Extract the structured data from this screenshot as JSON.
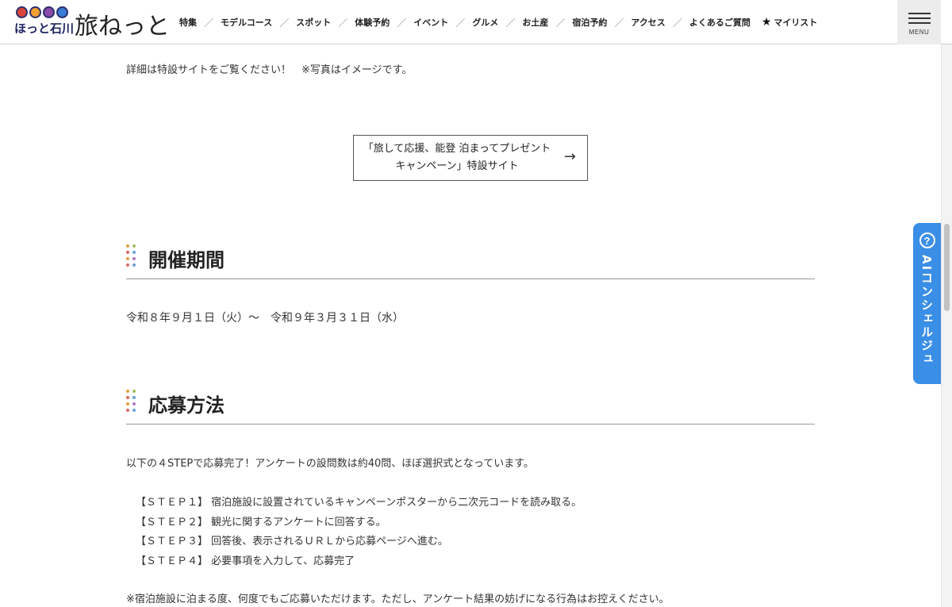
{
  "header": {
    "logo_small": "ほっと石川",
    "logo_big": "旅ねっと",
    "nav": [
      "特集",
      "モデルコース",
      "スポット",
      "体験予約",
      "イベント",
      "グルメ",
      "お土産",
      "宿泊予約",
      "アクセス",
      "よくあるご質問"
    ],
    "mylist_label": "マイリスト",
    "menu_label": "MENU",
    "logo_dot_colors": [
      "#d8443a",
      "#f0a030",
      "#8a4aa8",
      "#3a7bd5"
    ]
  },
  "content": {
    "intro": "詳細は特設サイトをご覧ください！　※写真はイメージです。",
    "link_label": "「旅して応援、能登 泊まってプレゼントキャンペーン」特設サイト",
    "period_heading": "開催期間",
    "period_text": "令和８年９月１日（火）～　令和９年３月３１日（水）",
    "method_heading": "応募方法",
    "method_intro": "以下の４STEPで応募完了！アンケートの設問数は約40問、ほぼ選択式となっています。",
    "steps": [
      "【ＳＴＥＰ１】 宿泊施設に設置されているキャンペーンポスターから二次元コードを読み取る。",
      "【ＳＴＥＰ２】 観光に関するアンケートに回答する。",
      "【ＳＴＥＰ３】 回答後、表示されるＵＲＬから応募ページへ進む。",
      "【ＳＴＥＰ４】 必要事項を入力して、応募完了"
    ],
    "note": "※宿泊施設に泊まる度、何度でもご応募いただけます。ただし、アンケート結果の妨げになる行為はお控えください。"
  },
  "concierge": {
    "label": "AIコンシェルジュ",
    "color": "#3a8ee6"
  },
  "heading_dot_colors": [
    "#e0a040",
    "#9fbf5a",
    "#d86a6a",
    "#6aa0d8",
    "#e0a040",
    "#b07ac8",
    "#d86a6a",
    "#6aa0d8"
  ]
}
